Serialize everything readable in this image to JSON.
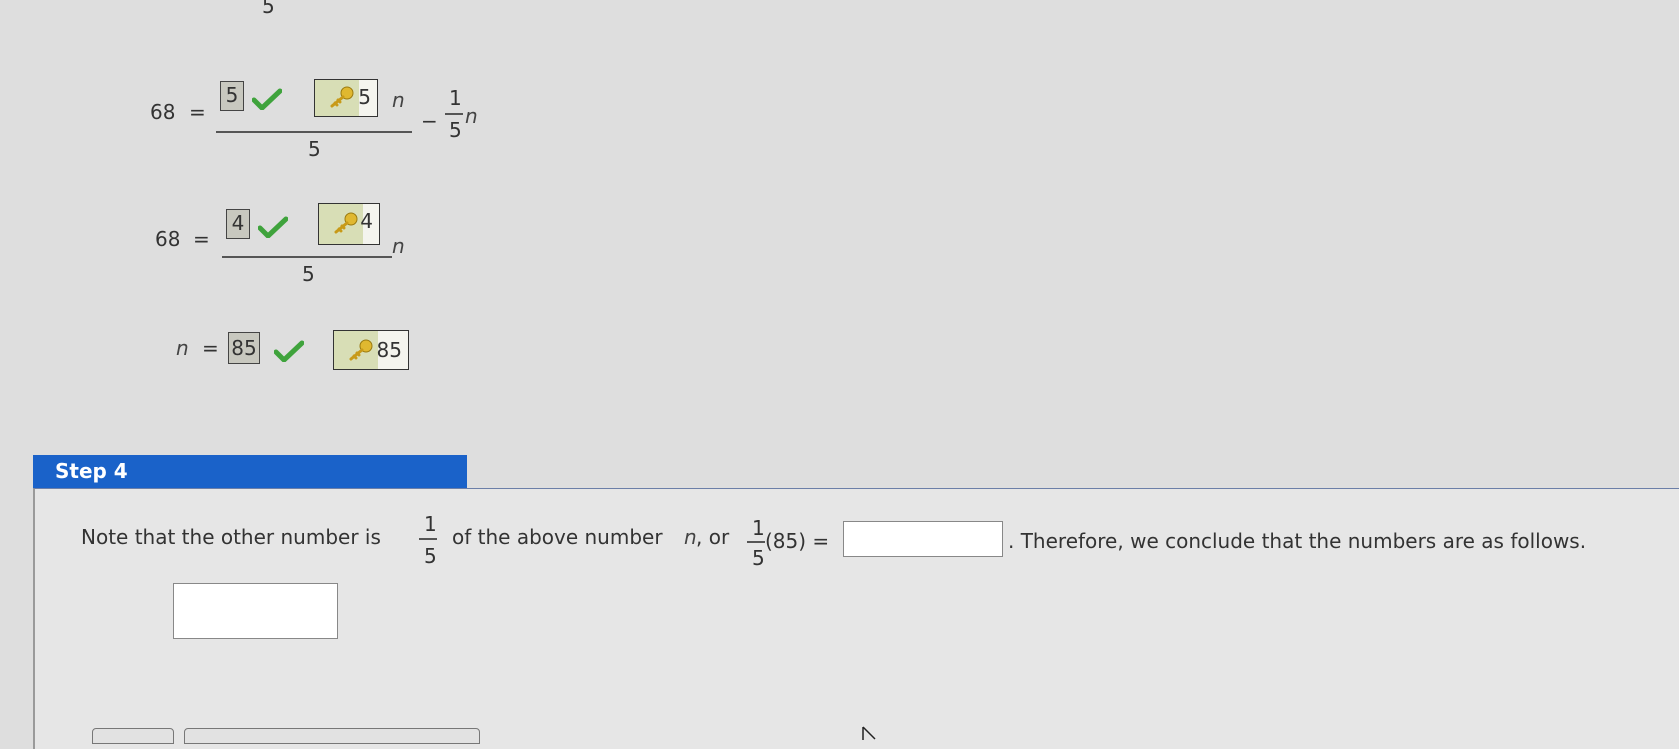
{
  "top_fragment": {
    "denominator": "5"
  },
  "row1": {
    "lhs": "68",
    "eq": "=",
    "answer": "5",
    "key_value": "5",
    "var_n": "n",
    "denominator": "5",
    "minus": "−",
    "frac_num": "1",
    "frac_den": "5",
    "tail_n": "n"
  },
  "row2": {
    "lhs": "68",
    "eq": "=",
    "answer": "4",
    "key_value": "4",
    "var_n": "n",
    "denominator": "5"
  },
  "row3": {
    "var_n": "n",
    "eq": "=",
    "answer": "85",
    "key_value": "85"
  },
  "step4": {
    "title": "Step 4",
    "text_a": "Note that the other number is",
    "frac1_num": "1",
    "frac1_den": "5",
    "text_b": "of the above number",
    "var_n": "n",
    "text_c": ", or",
    "frac2_num": "1",
    "frac2_den": "5",
    "text_d": "(85) =",
    "text_e": ". Therefore, we conclude that the numbers are as follows.",
    "answer_input_value": "",
    "numbers_input_value": ""
  },
  "icons": {
    "check": "check-icon",
    "key": "key-icon",
    "cursor": "cursor-icon"
  },
  "colors": {
    "check_green": "#3fa33c",
    "step_header": "#1a62c9",
    "answer_bg": "#c8c8bf",
    "key_bg": "#d8deb6"
  }
}
